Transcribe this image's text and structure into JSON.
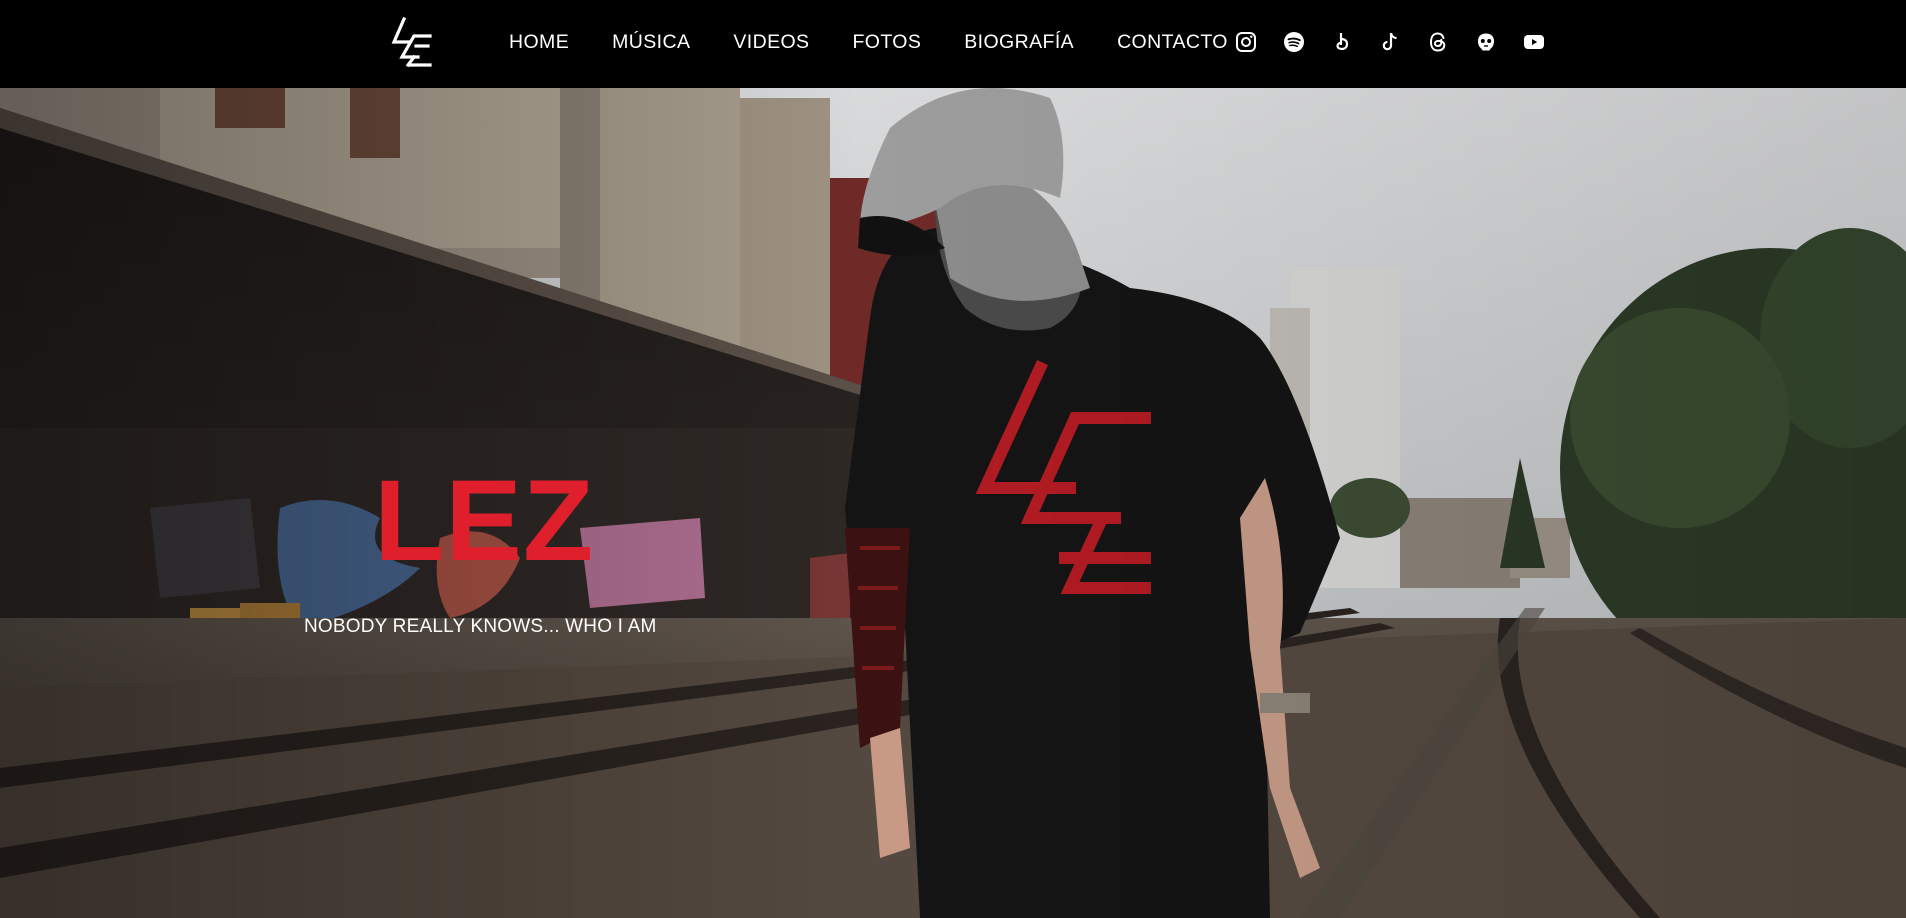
{
  "nav": {
    "logo_alt": "LEZ logo",
    "items": [
      {
        "label": "HOME"
      },
      {
        "label": "MÚSICA"
      },
      {
        "label": "VIDEOS"
      },
      {
        "label": "FOTOS"
      },
      {
        "label": "BIOGRAFÍA"
      },
      {
        "label": "CONTACTO"
      }
    ],
    "socials": [
      {
        "icon": "instagram-icon"
      },
      {
        "icon": "spotify-icon"
      },
      {
        "icon": "music-note-icon"
      },
      {
        "icon": "tiktok-icon"
      },
      {
        "icon": "threads-icon"
      },
      {
        "icon": "bandcamp-face-icon"
      },
      {
        "icon": "youtube-icon"
      }
    ]
  },
  "hero": {
    "title": "LEZ",
    "subtitle": "NOBODY REALLY KNOWS... WHO I AM"
  },
  "colors": {
    "accent": "#e01f2d",
    "nav_background": "#000000",
    "text": "#ffffff"
  }
}
